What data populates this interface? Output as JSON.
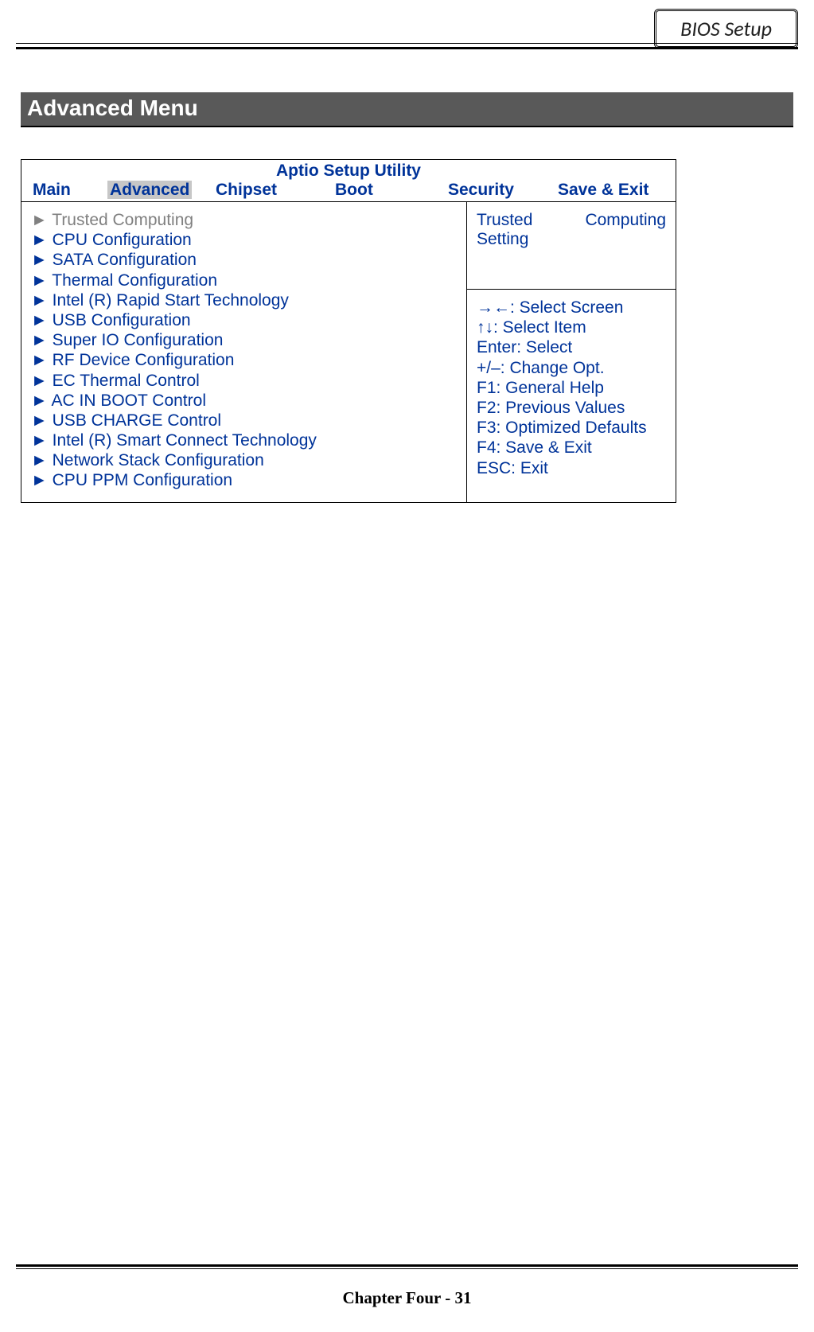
{
  "header": {
    "badge": "BIOS Setup"
  },
  "section": {
    "title": "Advanced Menu"
  },
  "bios": {
    "title": "Aptio Setup Utility",
    "tabs": {
      "main": "Main",
      "advanced": "Advanced",
      "chipset": "Chipset",
      "boot": "Boot",
      "security": "Security",
      "save_exit": "Save & Exit"
    },
    "menu_items": [
      "Trusted Computing",
      "CPU Configuration",
      "SATA Configuration",
      "Thermal Configuration",
      "Intel (R) Rapid Start Technology",
      "USB Configuration",
      "Super IO Configuration",
      "RF Device Configuration",
      "EC Thermal Control",
      "AC IN BOOT Control",
      "USB CHARGE Control",
      "Intel (R) Smart Connect Technology",
      "Network Stack Configuration",
      "CPU PPM Configuration"
    ],
    "arrow": "►",
    "info": {
      "word1": "Trusted",
      "word2": "Computing",
      "word3": "Setting"
    },
    "help": [
      "→←: Select Screen",
      "↑↓: Select Item",
      "Enter: Select",
      "+/–: Change Opt.",
      "F1: General Help",
      "F2: Previous Values",
      "F3: Optimized Defaults",
      "F4: Save & Exit",
      "ESC: Exit"
    ]
  },
  "footer": {
    "text": "Chapter Four - 31"
  }
}
